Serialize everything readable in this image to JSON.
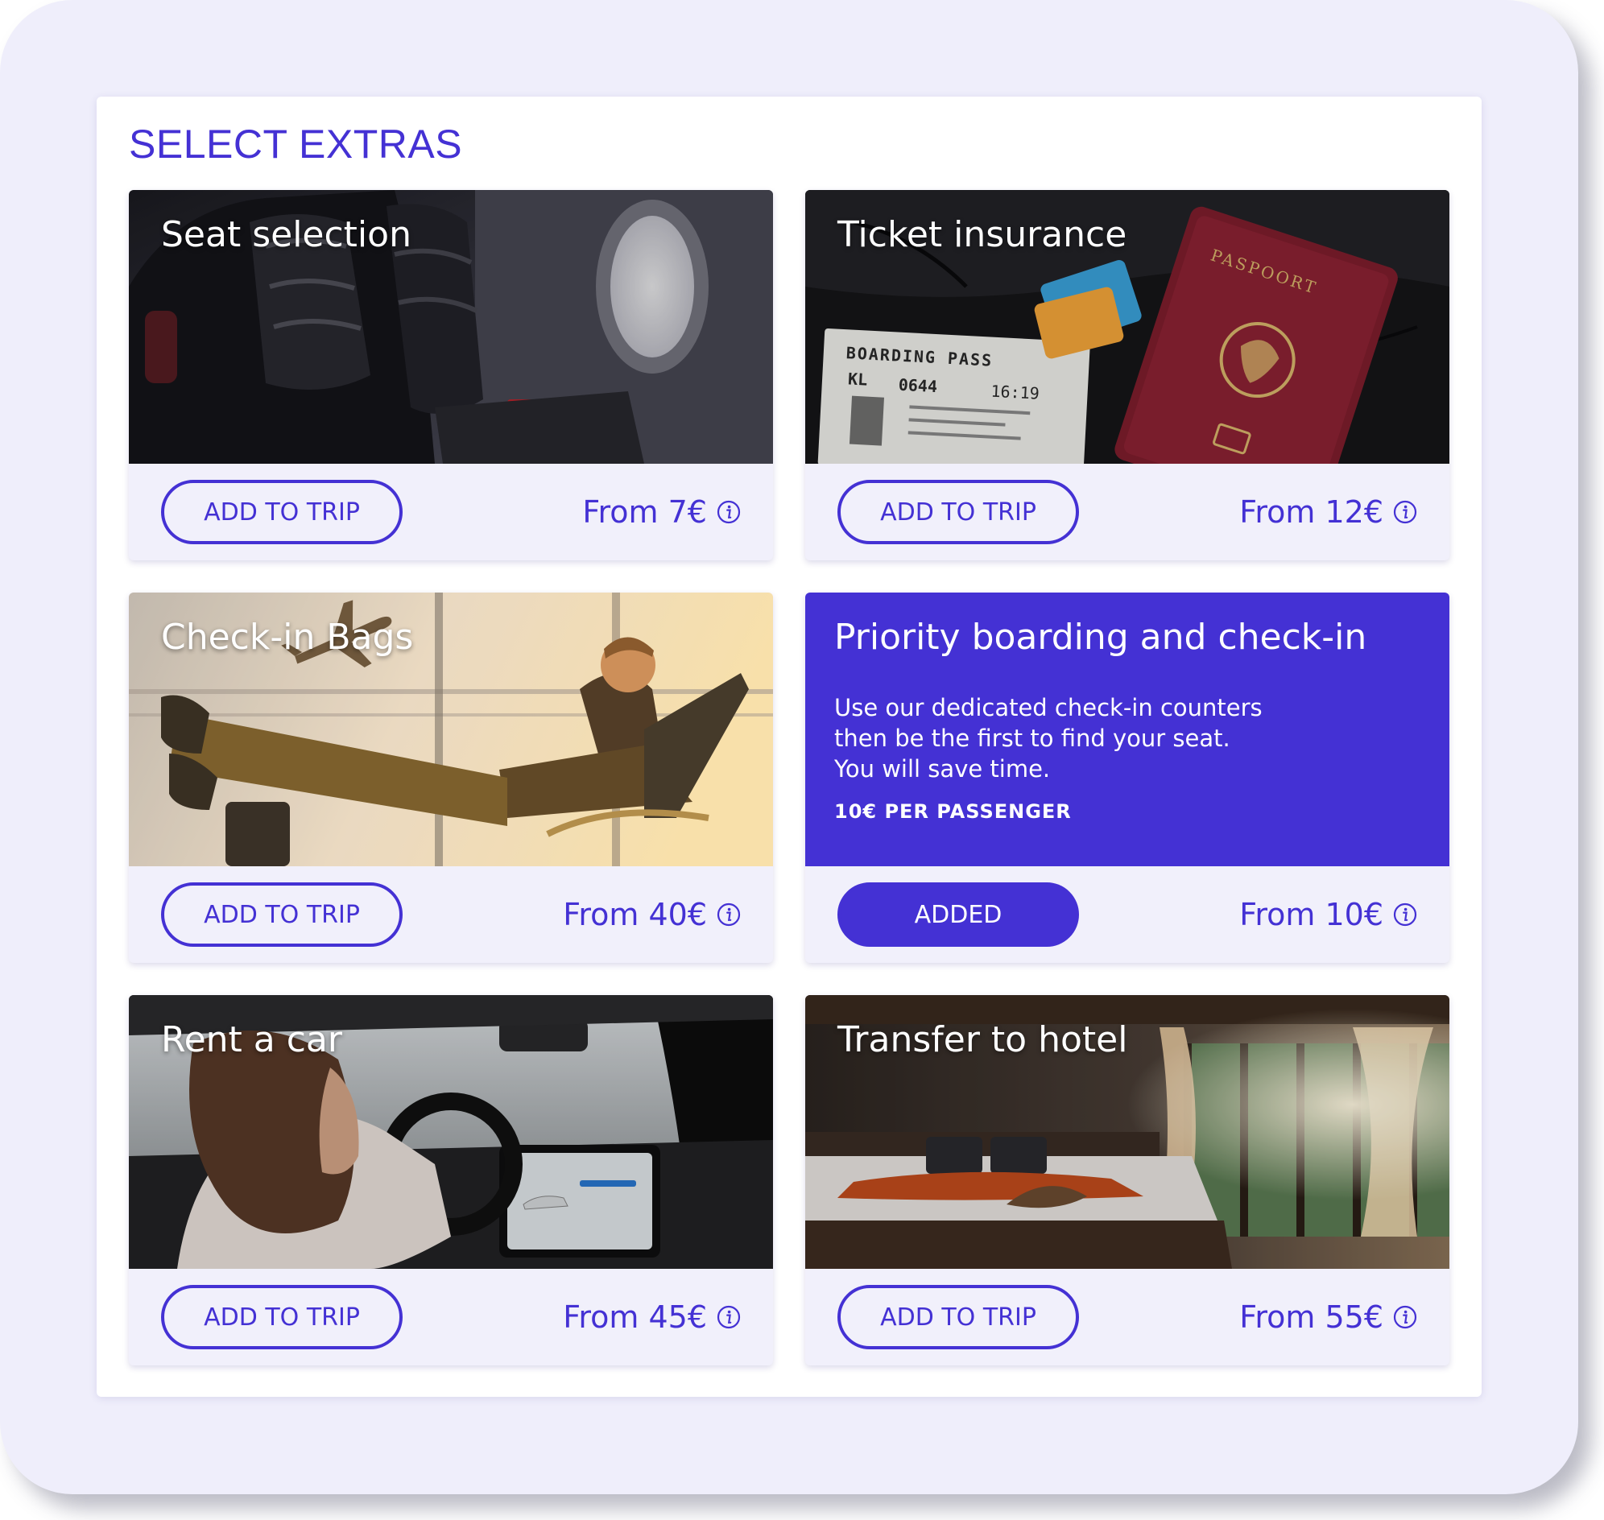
{
  "panel": {
    "title": "SELECT EXTRAS"
  },
  "extras": [
    {
      "id": "seat",
      "title": "Seat selection",
      "button_label": "ADD TO TRIP",
      "price": "From 7€",
      "image": "airplane-seat-photo"
    },
    {
      "id": "insurance",
      "title": "Ticket insurance",
      "button_label": "ADD TO TRIP",
      "price": "From 12€",
      "image": "boarding-pass-passport-photo",
      "boarding_pass": {
        "header": "BOARDING PASS",
        "carrier": "KL",
        "flight": "0644",
        "time": "16:19"
      },
      "passport_label": "PASPOORT"
    },
    {
      "id": "bags",
      "title": "Check-in Bags",
      "button_label": "ADD TO TRIP",
      "price": "From 40€",
      "image": "airport-lounge-traveler-photo"
    },
    {
      "id": "priority",
      "title": "Priority boarding and check-in",
      "description": [
        "Use our dedicated check-in counters",
        "then be the first to find your seat.",
        "You will save time."
      ],
      "rate": "10€ PER PASSENGER",
      "button_label": "ADDED",
      "price": "From 10€"
    },
    {
      "id": "car",
      "title": "Rent a car",
      "button_label": "ADD TO TRIP",
      "price": "From 45€",
      "image": "car-interior-driver-photo"
    },
    {
      "id": "hotel",
      "title": "Transfer to hotel",
      "button_label": "ADD TO TRIP",
      "price": "From 55€",
      "image": "hotel-bedroom-photo"
    }
  ],
  "colors": {
    "accent": "#4431d4",
    "background": "#efeefb",
    "card_footer": "#f1f0fb",
    "panel": "#ffffff"
  },
  "icons": {
    "price_info": "info-icon"
  }
}
